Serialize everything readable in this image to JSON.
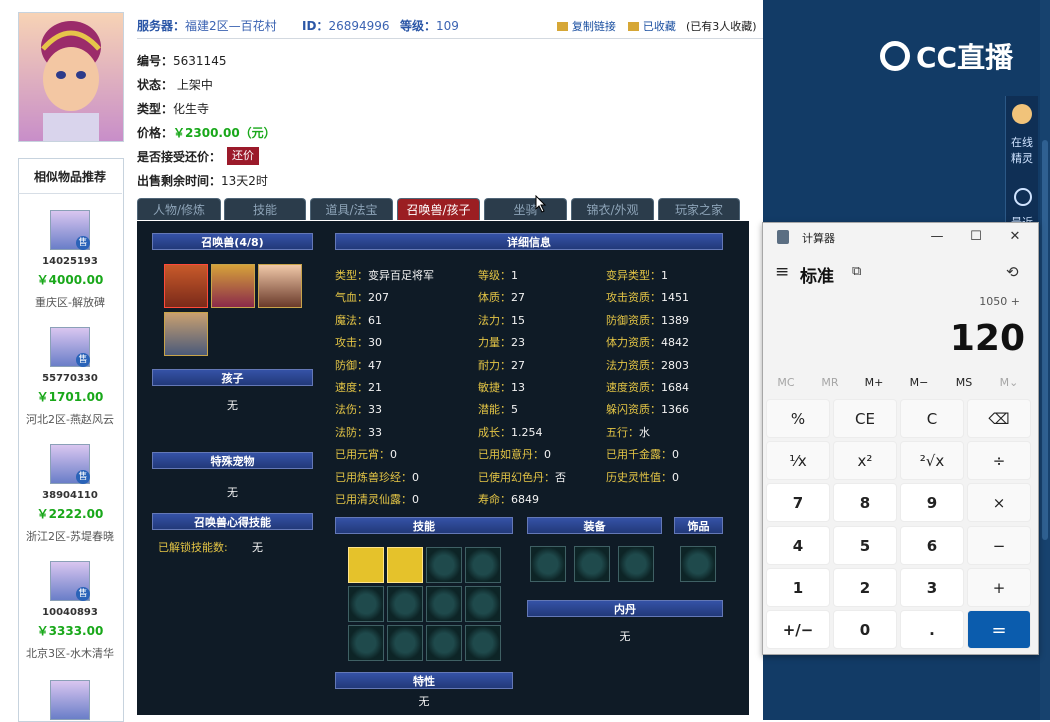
{
  "header": {
    "server_label": "服务器：",
    "server_value": "福建2区—百花村",
    "id_label": "ID：",
    "id_value": "26894996",
    "level_label": "等级：",
    "level_value": "109",
    "copy_link": "复制链接",
    "favorited": "已收藏",
    "fav_count": "(已有3人收藏)"
  },
  "info": {
    "number_label": "编号：",
    "number_value": "5631145",
    "status_label": "状态：",
    "status_value": "上架中",
    "type_label": "类型：",
    "type_value": "化生寺",
    "price_label": "价格：",
    "price_value": "￥2300.00（元）",
    "counter_label": "是否接受还价：",
    "counter_button": "还价",
    "remaining_label": "出售剩余时间：",
    "remaining_value": "13天2时"
  },
  "recommend": {
    "title": "相似物品推荐",
    "badge": "售",
    "items": [
      {
        "id": "14025193",
        "price": "￥4000.00",
        "server": "重庆区-解放碑"
      },
      {
        "id": "55770330",
        "price": "￥1701.00",
        "server": "河北2区-燕赵风云"
      },
      {
        "id": "38904110",
        "price": "￥2222.00",
        "server": "浙江2区-苏堤春晓"
      },
      {
        "id": "10040893",
        "price": "￥3333.00",
        "server": "北京3区-水木清华"
      }
    ]
  },
  "tabs": [
    "人物/修炼",
    "技能",
    "道具/法宝",
    "召唤兽/孩子",
    "坐骑",
    "锦衣/外观",
    "玩家之家"
  ],
  "game": {
    "pets_bar": "召唤兽(4/8)",
    "detail_bar": "详细信息",
    "child_bar": "孩子",
    "child_value": "无",
    "special_bar": "特殊宠物",
    "special_value": "无",
    "insight_bar": "召唤兽心得技能",
    "unlocked_label": "已解锁技能数:",
    "unlocked_value": "无",
    "skills_bar": "技能",
    "equip_bar": "装备",
    "accessory_bar": "饰品",
    "neidan_bar": "内丹",
    "neidan_value": "无",
    "trait_bar": "特性",
    "trait_value": "无",
    "stats": [
      [
        "类型：",
        "变异百足将军",
        "等级：",
        "1",
        "变异类型：",
        "1"
      ],
      [
        "气血：",
        "207",
        "体质：",
        "27",
        "攻击资质：",
        "1451"
      ],
      [
        "魔法：",
        "61",
        "法力：",
        "15",
        "防御资质：",
        "1389"
      ],
      [
        "攻击：",
        "30",
        "力量：",
        "23",
        "体力资质：",
        "4842"
      ],
      [
        "防御：",
        "47",
        "耐力：",
        "27",
        "法力资质：",
        "2803"
      ],
      [
        "速度：",
        "21",
        "敏捷：",
        "13",
        "速度资质：",
        "1684"
      ],
      [
        "法伤：",
        "33",
        "潜能：",
        "5",
        "躲闪资质：",
        "1366"
      ],
      [
        "法防：",
        "33",
        "成长：",
        "1.254",
        "五行：",
        "水"
      ],
      [
        "已用元宵：",
        "0",
        "已用如意丹：",
        "0",
        "已用千金露：",
        "0"
      ],
      [
        "已用炼兽珍经：",
        "0",
        "已使用幻色丹：",
        "否",
        "历史灵性值：",
        "0"
      ],
      [
        "已用清灵仙露：",
        "0",
        "寿命：",
        "6849",
        "",
        ""
      ]
    ]
  },
  "stream": {
    "logo": "CC直播",
    "online_label": "在线\n精灵",
    "recent_label": "最近"
  },
  "calculator": {
    "app_title": "计算器",
    "mode": "标准",
    "expression": "1050 +",
    "display": "120",
    "minimize": "—",
    "maximize": "☐",
    "close": "✕",
    "menu_icon": "≡",
    "keep_on_top": "⧉",
    "history_icon": "⟲",
    "memory": [
      "MC",
      "MR",
      "M+",
      "M−",
      "MS",
      "M⌄"
    ],
    "keys": [
      [
        "%",
        "CE",
        "C",
        "⌫"
      ],
      [
        "¹⁄x",
        "x²",
        "²√x",
        "÷"
      ],
      [
        "7",
        "8",
        "9",
        "×"
      ],
      [
        "4",
        "5",
        "6",
        "−"
      ],
      [
        "1",
        "2",
        "3",
        "+"
      ],
      [
        "+/−",
        "0",
        ".",
        "="
      ]
    ]
  },
  "colors": {
    "accent_blue": "#2a56a6",
    "price_green": "#19a81a",
    "tab_active": "#9b1e22",
    "stat_gold": "#e4c545",
    "calc_equals": "#0b5cad",
    "stream_blue": "#123b66"
  }
}
